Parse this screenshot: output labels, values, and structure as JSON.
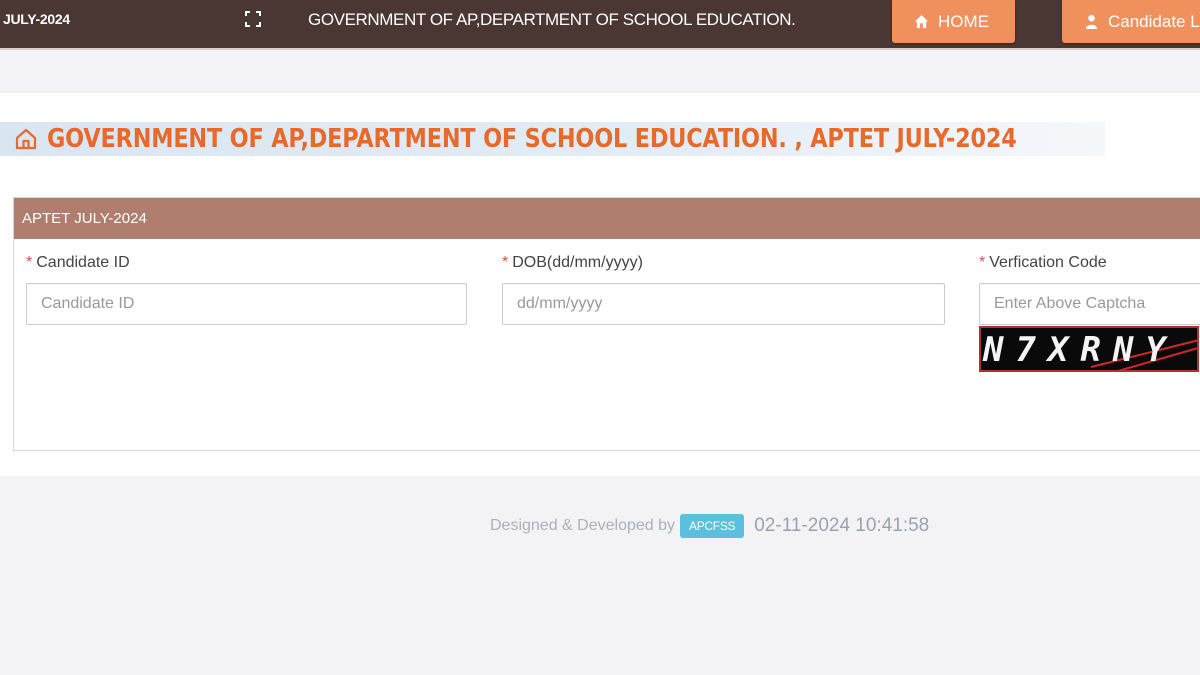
{
  "navbar": {
    "brand": "JULY-2024",
    "title": "GOVERNMENT OF AP,DEPARTMENT OF SCHOOL EDUCATION.",
    "fullscreen_icon": "expand-icon",
    "buttons": [
      {
        "label": "HOME",
        "icon": "home-icon"
      },
      {
        "label": "Candidate L",
        "icon": "user-icon"
      }
    ]
  },
  "page": {
    "title": "GOVERNMENT OF AP,DEPARTMENT OF SCHOOL EDUCATION. , APTET JULY-2024",
    "title_icon": "home-outline-icon",
    "accent_color": "#e8692a"
  },
  "panel": {
    "heading": "APTET JULY-2024",
    "heading_color": "#b07e6e",
    "fields": [
      {
        "label": "Candidate ID",
        "required_mark": "*",
        "placeholder": "Candidate ID",
        "value": ""
      },
      {
        "label": "DOB(dd/mm/yyyy)",
        "required_mark": "*",
        "placeholder": "dd/mm/yyyy",
        "value": ""
      },
      {
        "label": "Verfication Code",
        "required_mark": "*",
        "placeholder": "Enter Above Captcha",
        "value": ""
      }
    ],
    "captcha_text": "N7XRNY"
  },
  "footer": {
    "designed_by": "Designed & Developed by",
    "badge": "APCFSS",
    "timestamp": "02-11-2024 10:41:58"
  }
}
